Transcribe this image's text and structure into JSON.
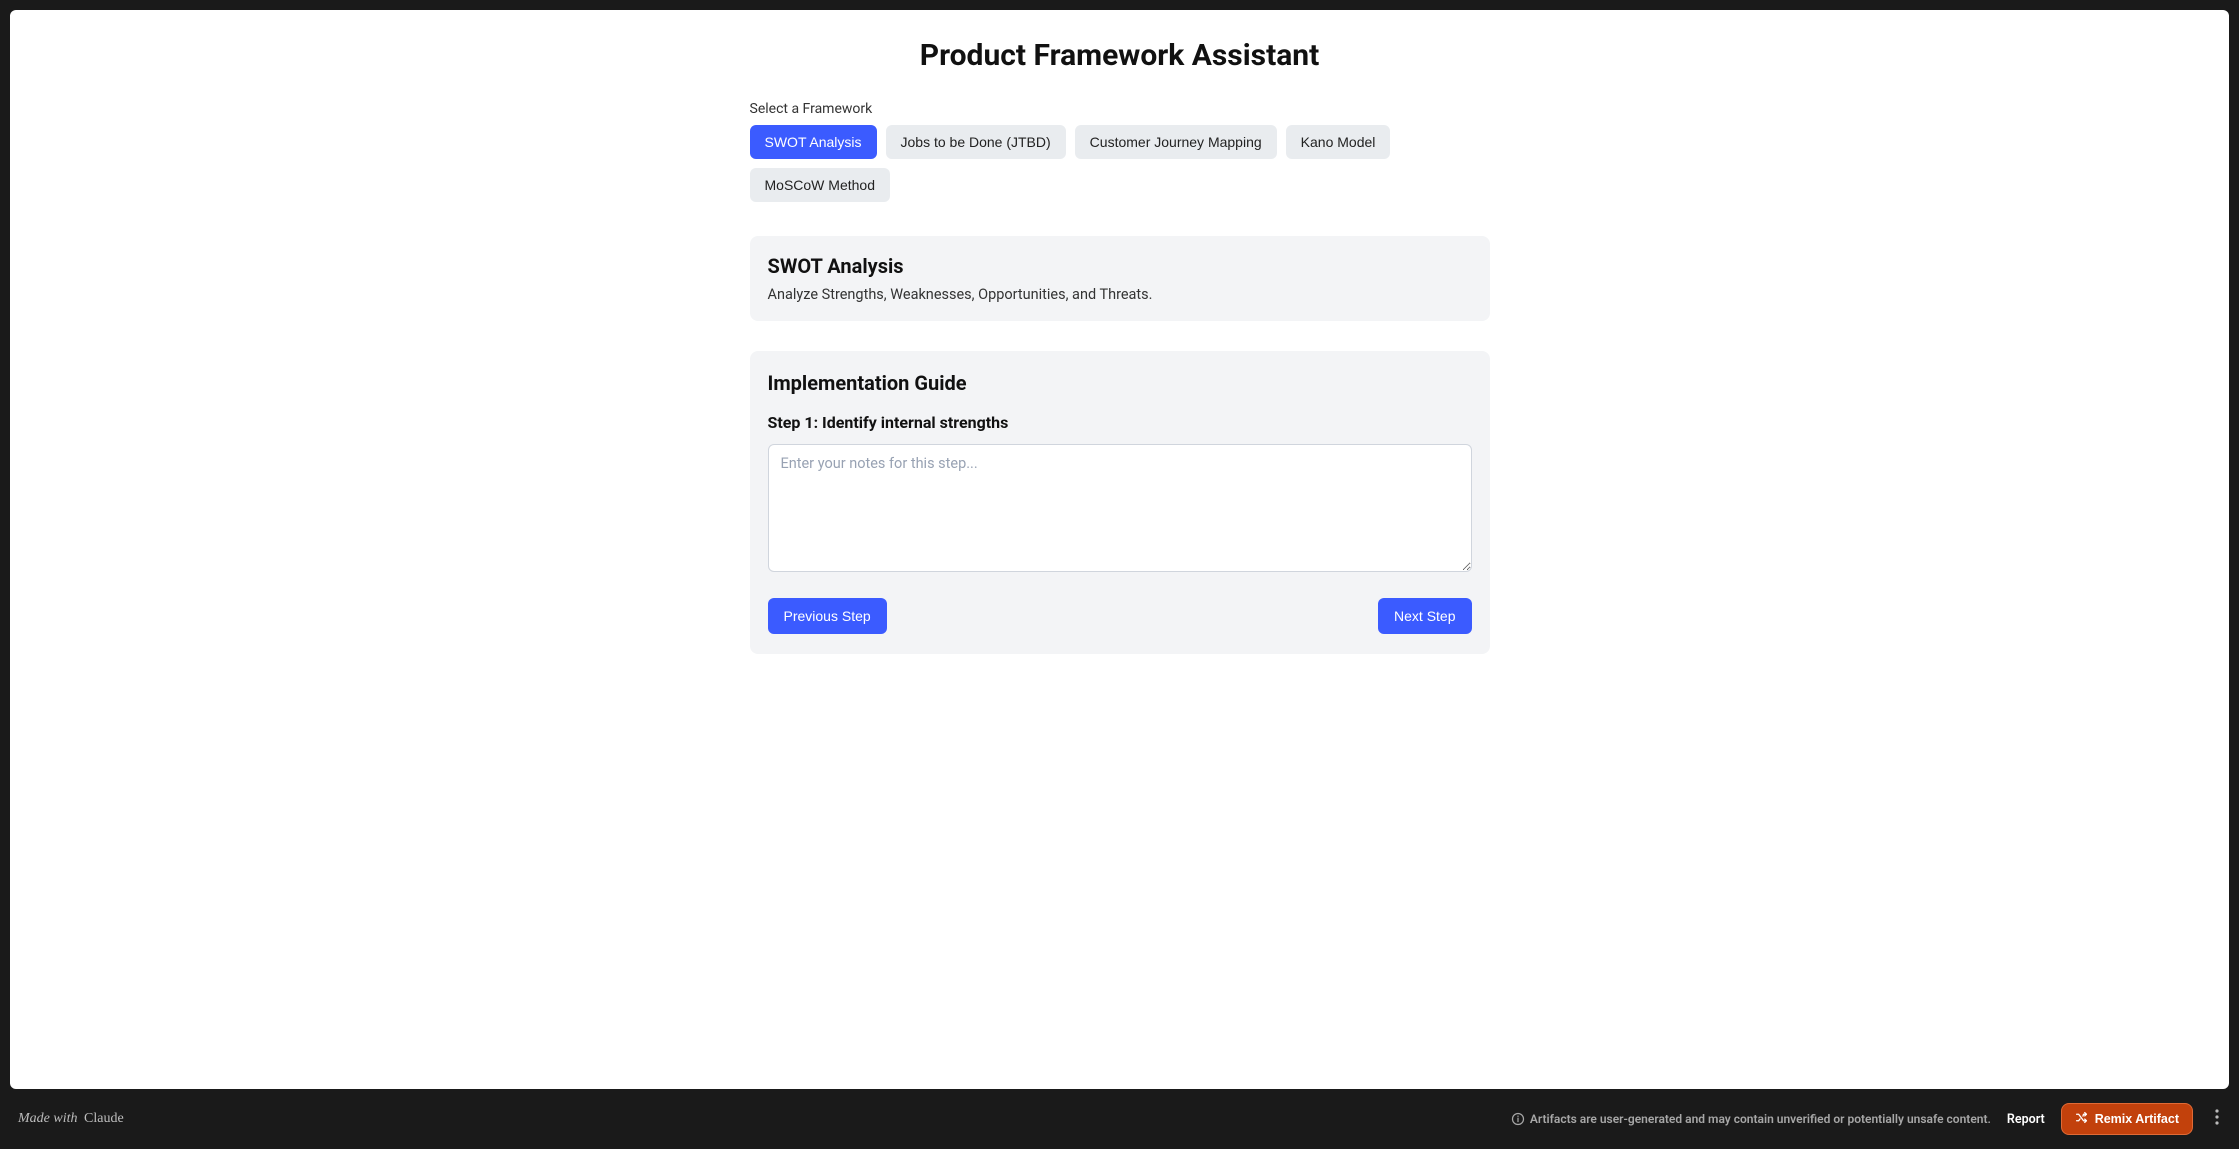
{
  "page_title": "Product Framework Assistant",
  "select_label": "Select a Framework",
  "frameworks": [
    {
      "label": "SWOT Analysis",
      "active": true
    },
    {
      "label": "Jobs to be Done (JTBD)",
      "active": false
    },
    {
      "label": "Customer Journey Mapping",
      "active": false
    },
    {
      "label": "Kano Model",
      "active": false
    },
    {
      "label": "MoSCoW Method",
      "active": false
    }
  ],
  "framework_info": {
    "title": "SWOT Analysis",
    "description": "Analyze Strengths, Weaknesses, Opportunities, and Threats."
  },
  "guide": {
    "title": "Implementation Guide",
    "step_label": "Step 1: Identify internal strengths",
    "textarea_placeholder": "Enter your notes for this step...",
    "textarea_value": "",
    "prev_label": "Previous Step",
    "next_label": "Next Step"
  },
  "footer": {
    "made_with_prefix": "Made with",
    "made_with_brand": "Claude",
    "disclaimer": "Artifacts are user-generated and may contain unverified or potentially unsafe content.",
    "report_label": "Report",
    "remix_label": "Remix Artifact"
  }
}
